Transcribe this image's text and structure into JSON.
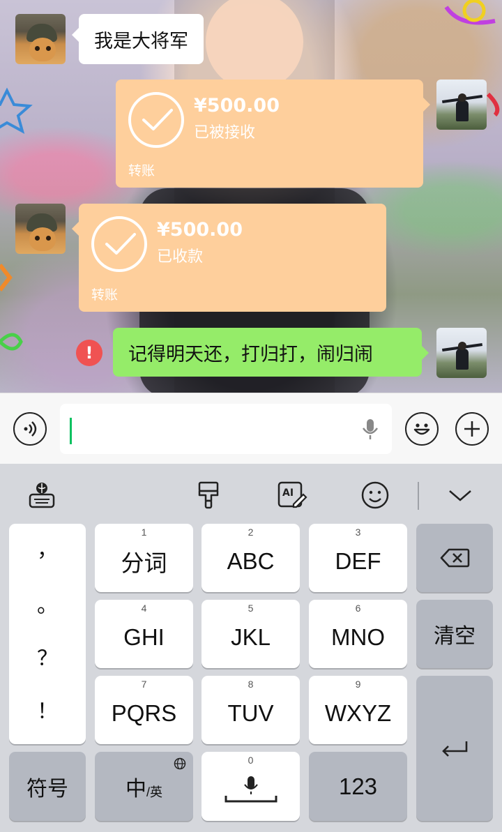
{
  "chat": {
    "messages": [
      {
        "side": "left",
        "type": "text",
        "text": "我是大将军",
        "avatar": "cat-soldier-avatar"
      },
      {
        "side": "right",
        "type": "transfer",
        "amount": "¥500.00",
        "status": "已被接收",
        "label": "转账",
        "avatar": "man-outdoor-avatar"
      },
      {
        "side": "left",
        "type": "transfer",
        "amount": "¥500.00",
        "status": "已收款",
        "label": "转账",
        "avatar": "cat-soldier-avatar"
      },
      {
        "side": "right",
        "type": "text",
        "text": "记得明天还，打归打，闹归闹",
        "failed_icon": "!",
        "avatar": "man-outdoor-avatar"
      }
    ]
  },
  "input_bar": {
    "voice_icon": "voice-mode-icon",
    "text_value": "",
    "mic_icon": "microphone-icon",
    "emoji_icon": "emoji-icon",
    "more_icon": "plus-icon"
  },
  "keyboard": {
    "toolbar": {
      "icons": [
        "keyboard-globe-icon",
        "brush-icon",
        "ai-edit-icon",
        "emoji-icon",
        "collapse-chevron-icon"
      ]
    },
    "punctuation": [
      "，",
      "。",
      "？",
      "！"
    ],
    "keys": [
      {
        "num": "1",
        "label": "分词"
      },
      {
        "num": "2",
        "label": "ABC"
      },
      {
        "num": "3",
        "label": "DEF"
      },
      {
        "num": "4",
        "label": "GHI"
      },
      {
        "num": "5",
        "label": "JKL"
      },
      {
        "num": "6",
        "label": "MNO"
      },
      {
        "num": "7",
        "label": "PQRS"
      },
      {
        "num": "8",
        "label": "TUV"
      },
      {
        "num": "9",
        "label": "WXYZ"
      }
    ],
    "clear_label": "清空",
    "symbols_label": "符号",
    "lang_label_main": "中",
    "lang_label_sub": "/英",
    "space_num": "0",
    "num_mode_label": "123"
  },
  "colors": {
    "transfer_bubble": "#fecf9c",
    "sent_bubble": "#95ec69",
    "caret": "#07c160",
    "error": "#f05252"
  }
}
